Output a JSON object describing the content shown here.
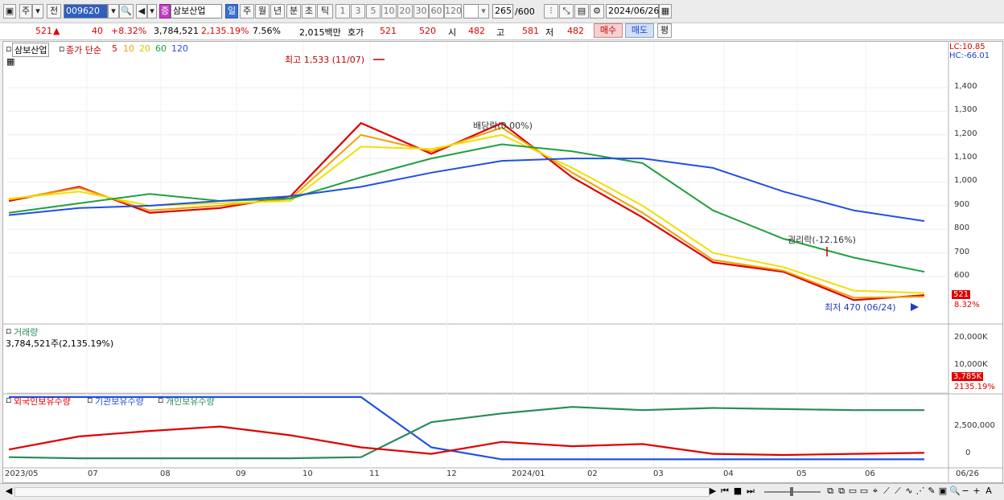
{
  "toolbar": {
    "period_label": "주",
    "prev_label": "전",
    "code": "009620",
    "stock_badge": "증",
    "stock_name": "삼보산업",
    "tabs": [
      "일",
      "주",
      "월",
      "년",
      "분",
      "초",
      "틱"
    ],
    "minute_options": [
      "1",
      "3",
      "5",
      "10",
      "20",
      "30",
      "60",
      "120"
    ],
    "count": "265",
    "count_total": "/600",
    "date": "2024/06/26"
  },
  "quote": {
    "price": "521",
    "change_arrow": "▲",
    "change": "40",
    "change_pct": "+8.32%",
    "volume": "3,784,521",
    "volume_pct": "2,135.19%",
    "turnover_pct": "7.56%",
    "amount": "2,015백만",
    "hoga_label": "호가",
    "ask": "521",
    "bid": "520",
    "open_label": "시",
    "open": "482",
    "high_label": "고",
    "high": "581",
    "low_label": "저",
    "low": "482",
    "buy_label": "매수",
    "sell_label": "매도",
    "eval_label": "평"
  },
  "price_panel": {
    "stock_label": "삼보산업",
    "ma_label": "종가 단순",
    "ma_periods": [
      "5",
      "10",
      "20",
      "60",
      "120"
    ],
    "ma_colors": [
      "#e00000",
      "#f0a000",
      "#f0e000",
      "#20a040",
      "#2050e0"
    ],
    "lc": "LC:10.85",
    "hc": "HC:-66.01",
    "y_ticks": [
      "1,400",
      "1,300",
      "1,200",
      "1,100",
      "1,000",
      "900",
      "800",
      "700",
      "600"
    ],
    "high_annot": "최고 1,533 (11/07)",
    "low_annot": "최저 470 (06/24)",
    "dividend_annot": "배당락(0.00%)",
    "rights_annot": "권리락(-12.16%)",
    "last_price_tag": "521",
    "last_pct_tag": "8.32%"
  },
  "volume_panel": {
    "title": "거래량",
    "value": "3,784,521주(2,135.19%)",
    "y_ticks": [
      "20,000K",
      "10,000K"
    ],
    "tag_value": "3,785K",
    "tag_pct": "2135.19%"
  },
  "holding_panel": {
    "legend": [
      "외국인보유수량",
      "기관보유수량",
      "개인보유수량"
    ],
    "legend_colors": [
      "#e00000",
      "#2050e0",
      "#2a8a5a"
    ],
    "y_ticks": [
      "2,500,000",
      "0"
    ]
  },
  "x_axis": {
    "labels": [
      "2023/05",
      "07",
      "08",
      "09",
      "10",
      "11",
      "12",
      "2024/01",
      "02",
      "03",
      "04",
      "05",
      "06"
    ],
    "end_label": "06/26"
  },
  "chart_data": {
    "type": "line",
    "xlabel": "",
    "ylabel": "",
    "ylim": [
      440,
      1560
    ],
    "x": [
      "2023/05",
      "07",
      "08",
      "09",
      "10",
      "11",
      "12",
      "2024/01",
      "02",
      "03",
      "04",
      "05",
      "06",
      "06/26"
    ],
    "series": [
      {
        "name": "5",
        "values": [
          920,
          980,
          870,
          890,
          940,
          1250,
          1120,
          1250,
          1020,
          850,
          660,
          620,
          500,
          521
        ]
      },
      {
        "name": "10",
        "values": [
          925,
          975,
          880,
          900,
          930,
          1200,
          1130,
          1230,
          1040,
          870,
          670,
          625,
          510,
          515
        ]
      },
      {
        "name": "20",
        "values": [
          930,
          960,
          900,
          910,
          920,
          1150,
          1140,
          1200,
          1060,
          900,
          700,
          640,
          540,
          530
        ]
      },
      {
        "name": "60",
        "values": [
          870,
          910,
          950,
          920,
          930,
          1020,
          1100,
          1160,
          1130,
          1080,
          880,
          760,
          680,
          620
        ]
      },
      {
        "name": "120",
        "values": [
          860,
          890,
          900,
          920,
          940,
          980,
          1040,
          1090,
          1100,
          1100,
          1060,
          960,
          880,
          835
        ]
      }
    ]
  }
}
